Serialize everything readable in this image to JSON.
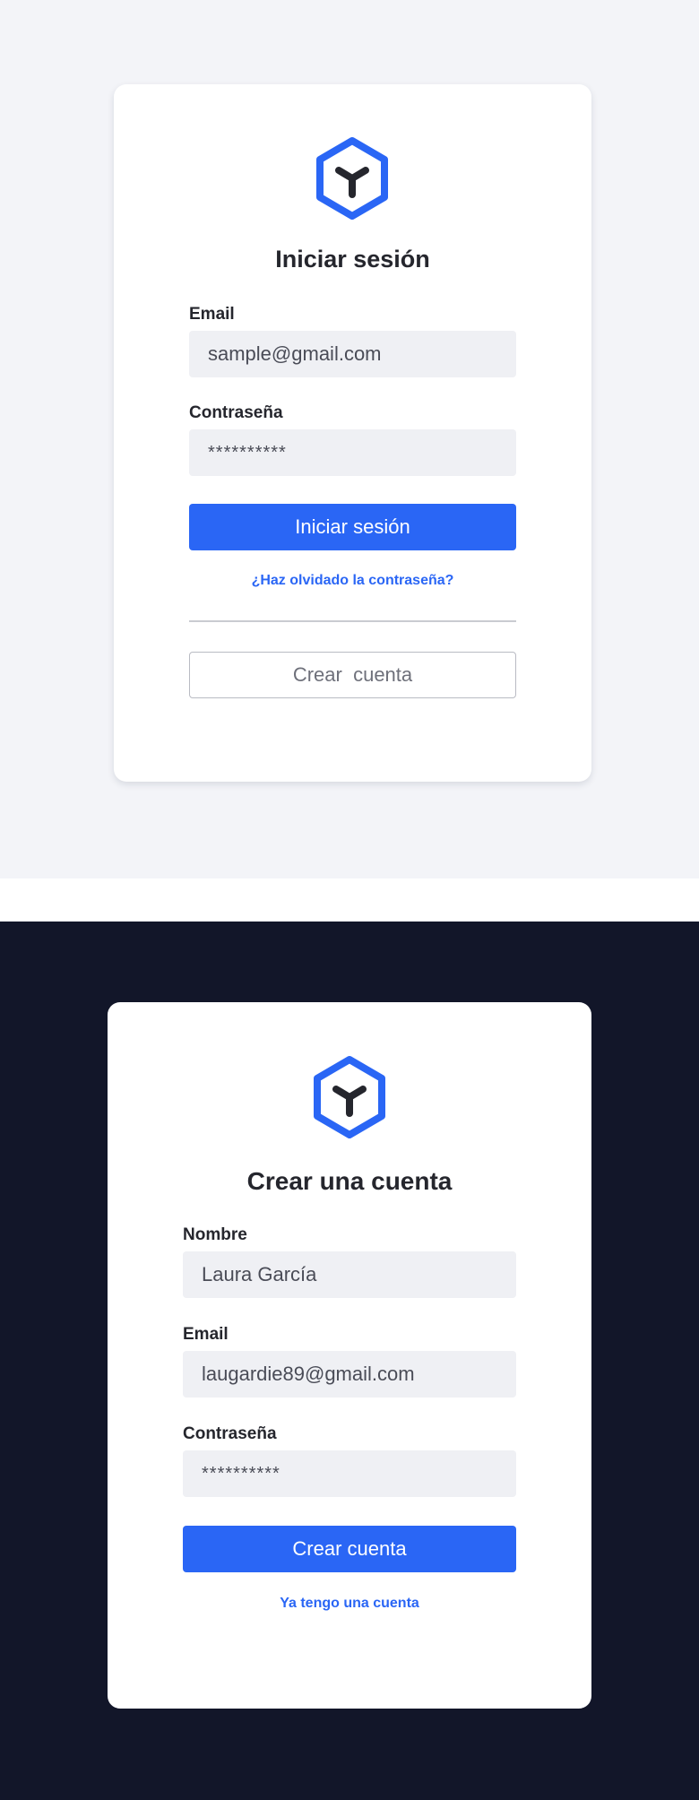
{
  "colors": {
    "accent": "#2a66f5",
    "light_background": "#f3f4f8",
    "dark_background": "#121629",
    "card": "#ffffff",
    "input_fill": "#eff0f4",
    "logo_mark": "#25262d"
  },
  "login": {
    "logo_icon": "hexagon-logo-icon",
    "title": "Iniciar sesión",
    "email_label": "Email",
    "email_value": "sample@gmail.com",
    "password_label": "Contraseña",
    "password_value": "**********",
    "submit_label": "Iniciar sesión",
    "forgot_link": "¿Haz olvidado la contraseña?",
    "create_account_label": "Crear  cuenta"
  },
  "signup": {
    "logo_icon": "hexagon-logo-icon",
    "title": "Crear una cuenta",
    "name_label": "Nombre",
    "name_value": "Laura García",
    "email_label": "Email",
    "email_value": "laugardie89@gmail.com",
    "password_label": "Contraseña",
    "password_value": "**********",
    "submit_label": "Crear cuenta",
    "have_account_link": "Ya tengo una cuenta"
  }
}
